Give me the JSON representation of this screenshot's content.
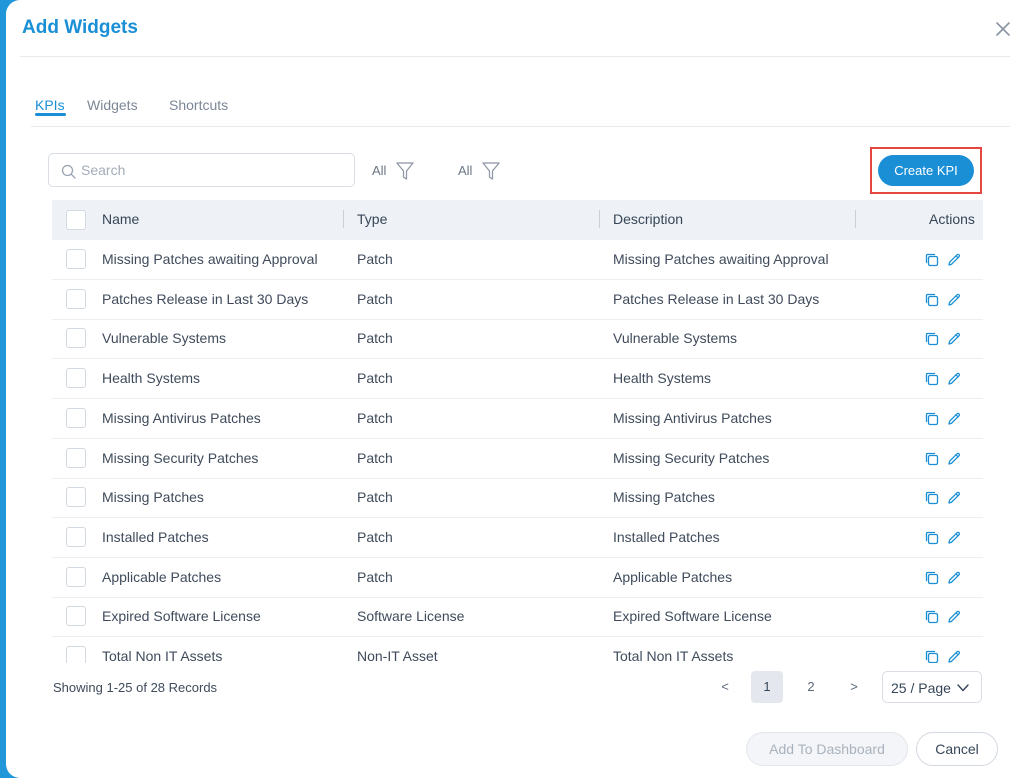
{
  "modal": {
    "title": "Add Widgets"
  },
  "tabs": [
    {
      "label": "KPIs",
      "active": true
    },
    {
      "label": "Widgets",
      "active": false
    },
    {
      "label": "Shortcuts",
      "active": false
    }
  ],
  "toolbar": {
    "search_placeholder": "Search",
    "filter1_label": "All",
    "filter2_label": "All",
    "create_label": "Create KPI"
  },
  "table": {
    "columns": [
      "Name",
      "Type",
      "Description",
      "Actions"
    ],
    "rows": [
      {
        "name": "Missing Patches awaiting Approval",
        "type": "Patch",
        "description": "Missing Patches awaiting Approval"
      },
      {
        "name": "Patches Release in Last 30 Days",
        "type": "Patch",
        "description": "Patches Release in Last 30 Days"
      },
      {
        "name": "Vulnerable Systems",
        "type": "Patch",
        "description": "Vulnerable Systems"
      },
      {
        "name": "Health Systems",
        "type": "Patch",
        "description": "Health Systems"
      },
      {
        "name": "Missing Antivirus Patches",
        "type": "Patch",
        "description": "Missing Antivirus Patches"
      },
      {
        "name": "Missing Security Patches",
        "type": "Patch",
        "description": "Missing Security Patches"
      },
      {
        "name": "Missing Patches",
        "type": "Patch",
        "description": "Missing Patches"
      },
      {
        "name": "Installed Patches",
        "type": "Patch",
        "description": "Installed Patches"
      },
      {
        "name": "Applicable Patches",
        "type": "Patch",
        "description": "Applicable Patches"
      },
      {
        "name": "Expired Software License",
        "type": "Software License",
        "description": "Expired Software License"
      },
      {
        "name": "Total Non IT Assets",
        "type": "Non-IT Asset",
        "description": "Total Non IT Assets"
      }
    ]
  },
  "pagination": {
    "records_text": "Showing 1-25 of 28 Records",
    "prev": "<",
    "next": ">",
    "pages": [
      "1",
      "2"
    ],
    "current_page": "1",
    "page_size": "25 / Page"
  },
  "footer": {
    "add_label": "Add To Dashboard",
    "cancel_label": "Cancel"
  },
  "colors": {
    "accent": "#1a8fd6",
    "highlight_border": "#e5463f",
    "backdrop": "#2196d8"
  }
}
